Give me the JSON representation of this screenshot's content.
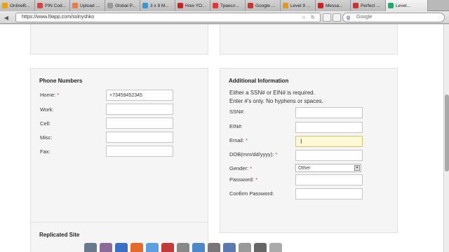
{
  "browser": {
    "tabs": [
      {
        "title": "OnlineB...",
        "color": "#f0a000"
      },
      {
        "title": "PIN Cod...",
        "color": "#d44"
      },
      {
        "title": "Upload ...",
        "color": "#e74"
      },
      {
        "title": "Global P...",
        "color": "#999"
      },
      {
        "title": "3 x 9 M...",
        "color": "#39c"
      },
      {
        "title": "How YO...",
        "color": "#c22"
      },
      {
        "title": "Трансл...",
        "color": "#e33"
      },
      {
        "title": "Google ...",
        "color": "#c33"
      },
      {
        "title": "Level 9 ...",
        "color": "#d92"
      },
      {
        "title": "Messa...",
        "color": "#c22"
      },
      {
        "title": "Perfect ...",
        "color": "#c33"
      },
      {
        "title": "Level...",
        "color": "#2a6"
      }
    ],
    "url": "https://www.l9app.com/solnyshko",
    "search_placeholder": "Google"
  },
  "phone": {
    "title": "Phone Numbers",
    "fields": [
      {
        "label": "Home:",
        "required": true,
        "value": "+73459452345"
      },
      {
        "label": "Work:",
        "required": false,
        "value": ""
      },
      {
        "label": "Cell:",
        "required": false,
        "value": ""
      },
      {
        "label": "Misc:",
        "required": false,
        "value": ""
      },
      {
        "label": "Fax:",
        "required": false,
        "value": ""
      }
    ]
  },
  "additional": {
    "title": "Additional Information",
    "note1": "Either a SSN# or EIN# is required.",
    "note2": "Enter #'s only. No hyphens or spaces.",
    "fields": [
      {
        "label": "SSN#:",
        "required": false
      },
      {
        "label": "EIN#:",
        "required": false
      },
      {
        "label": "Email:",
        "required": true
      },
      {
        "label": "DOB(mm/dd/yyyy):",
        "required": true
      }
    ],
    "gender_label": "Gender:",
    "gender_value": "Other",
    "password_label": "Password:",
    "confirm_label": "Confirm Password:"
  },
  "replicated": {
    "title": "Replicated Site"
  },
  "required_mark": "*"
}
